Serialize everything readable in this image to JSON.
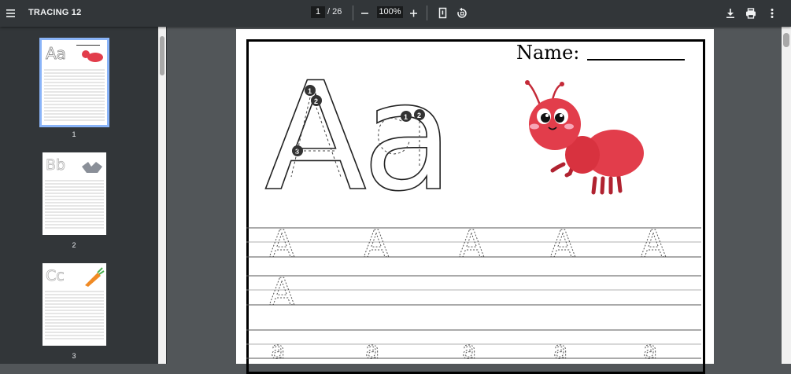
{
  "toolbar": {
    "title": "TRACING 12",
    "current_page": "1",
    "page_total": "/ 26",
    "zoom": "100%"
  },
  "sidebar": {
    "thumbnails": [
      {
        "label": "1",
        "letters": "Aa"
      },
      {
        "label": "2",
        "letters": "Bb"
      },
      {
        "label": "3",
        "letters": "Cc"
      }
    ]
  },
  "worksheet": {
    "name_label": "Name:",
    "big_letters": "Aa",
    "trace_upper": "A",
    "trace_lower": "a"
  },
  "colors": {
    "toolbar_bg": "#323639",
    "viewer_bg": "#525659",
    "ant_red": "#e23d4b",
    "thumb_selected": "#8ab4f8"
  },
  "icons": [
    "menu-icon",
    "zoom-out-icon",
    "zoom-in-icon",
    "fit-page-icon",
    "rotate-icon",
    "download-icon",
    "print-icon",
    "more-vert-icon",
    "ant-illustration"
  ]
}
